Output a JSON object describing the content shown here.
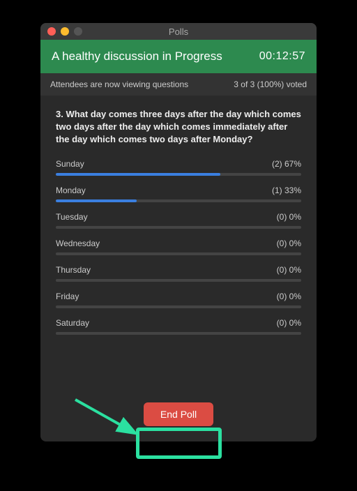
{
  "window": {
    "title": "Polls"
  },
  "header": {
    "title": "A healthy discussion in Progress",
    "timer": "00:12:57"
  },
  "status": {
    "left": "Attendees are now viewing questions",
    "right": "3 of 3 (100%) voted"
  },
  "question": {
    "text": "3. What day comes three days after the day which comes two days after the day which comes immediately after the day which comes two days after Monday?"
  },
  "options": [
    {
      "label": "Sunday",
      "count": "(2) 67%",
      "pct": 67
    },
    {
      "label": "Monday",
      "count": "(1) 33%",
      "pct": 33
    },
    {
      "label": "Tuesday",
      "count": "(0) 0%",
      "pct": 0
    },
    {
      "label": "Wednesday",
      "count": "(0) 0%",
      "pct": 0
    },
    {
      "label": "Thursday",
      "count": "(0) 0%",
      "pct": 0
    },
    {
      "label": "Friday",
      "count": "(0) 0%",
      "pct": 0
    },
    {
      "label": "Saturday",
      "count": "(0) 0%",
      "pct": 0
    }
  ],
  "footer": {
    "end_label": "End Poll"
  },
  "annotation": {
    "arrow_color": "#2be0a0"
  }
}
